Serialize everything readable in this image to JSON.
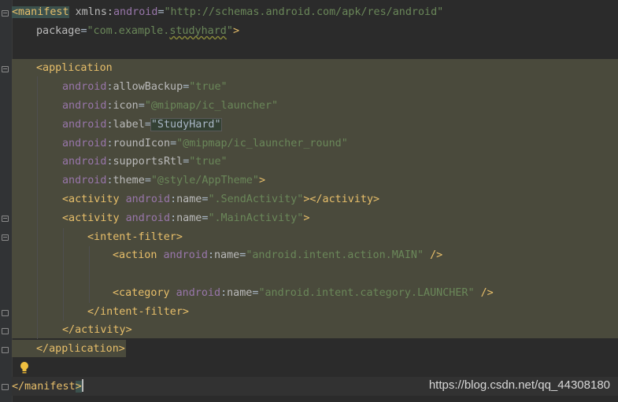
{
  "editor": {
    "lines": [
      {
        "id": "manifest-open",
        "tokens": [
          {
            "t": "tag",
            "v": "<manifest",
            "cls": "tag hl-manifest"
          },
          {
            "t": "plain",
            "v": " "
          },
          {
            "t": "attr",
            "v": "xmlns:"
          },
          {
            "t": "ns",
            "v": "android"
          },
          {
            "t": "plain",
            "v": "="
          },
          {
            "t": "val",
            "v": "\"http://schemas.android.com/apk/res/android\""
          }
        ]
      },
      {
        "id": "package",
        "tokens": [
          {
            "t": "attr",
            "v": "package"
          },
          {
            "t": "plain",
            "v": "="
          },
          {
            "t": "val",
            "v": "\"com.example."
          },
          {
            "t": "val",
            "v": "studyhard",
            "cls": "val squiggle"
          },
          {
            "t": "val",
            "v": "\""
          },
          {
            "t": "tag",
            "v": ">"
          }
        ]
      },
      {
        "id": "blank-1",
        "tokens": []
      },
      {
        "id": "application-open",
        "tokens": [
          {
            "t": "tag",
            "v": "<application"
          }
        ]
      },
      {
        "id": "allowBackup",
        "tokens": [
          {
            "t": "ns",
            "v": "android"
          },
          {
            "t": "plain",
            "v": ":"
          },
          {
            "t": "attr",
            "v": "allowBackup"
          },
          {
            "t": "plain",
            "v": "="
          },
          {
            "t": "val",
            "v": "\"true\""
          }
        ]
      },
      {
        "id": "icon",
        "tokens": [
          {
            "t": "ns",
            "v": "android"
          },
          {
            "t": "plain",
            "v": ":"
          },
          {
            "t": "attr",
            "v": "icon"
          },
          {
            "t": "plain",
            "v": "="
          },
          {
            "t": "val",
            "v": "\"@mipmap/ic_launcher\""
          }
        ]
      },
      {
        "id": "label",
        "tokens": [
          {
            "t": "ns",
            "v": "android"
          },
          {
            "t": "plain",
            "v": ":"
          },
          {
            "t": "attr",
            "v": "label"
          },
          {
            "t": "plain",
            "v": "="
          },
          {
            "t": "plain",
            "v": "\"StudyHard\"",
            "cls": "plain hl-label"
          }
        ]
      },
      {
        "id": "roundIcon",
        "tokens": [
          {
            "t": "ns",
            "v": "android"
          },
          {
            "t": "plain",
            "v": ":"
          },
          {
            "t": "attr",
            "v": "roundIcon"
          },
          {
            "t": "plain",
            "v": "="
          },
          {
            "t": "val",
            "v": "\"@mipmap/ic_launcher_round\""
          }
        ]
      },
      {
        "id": "supportsRtl",
        "tokens": [
          {
            "t": "ns",
            "v": "android"
          },
          {
            "t": "plain",
            "v": ":"
          },
          {
            "t": "attr",
            "v": "supportsRtl"
          },
          {
            "t": "plain",
            "v": "="
          },
          {
            "t": "val",
            "v": "\"true\""
          }
        ]
      },
      {
        "id": "theme",
        "tokens": [
          {
            "t": "ns",
            "v": "android"
          },
          {
            "t": "plain",
            "v": ":"
          },
          {
            "t": "attr",
            "v": "theme"
          },
          {
            "t": "plain",
            "v": "="
          },
          {
            "t": "val",
            "v": "\"@style/AppTheme\""
          },
          {
            "t": "tag",
            "v": ">"
          }
        ]
      },
      {
        "id": "activity-send",
        "tokens": [
          {
            "t": "tag",
            "v": "<activity "
          },
          {
            "t": "ns",
            "v": "android"
          },
          {
            "t": "plain",
            "v": ":"
          },
          {
            "t": "attr",
            "v": "name"
          },
          {
            "t": "plain",
            "v": "="
          },
          {
            "t": "val",
            "v": "\".SendActivity\""
          },
          {
            "t": "tag",
            "v": "></activity>"
          }
        ]
      },
      {
        "id": "activity-main",
        "tokens": [
          {
            "t": "tag",
            "v": "<activity "
          },
          {
            "t": "ns",
            "v": "android"
          },
          {
            "t": "plain",
            "v": ":"
          },
          {
            "t": "attr",
            "v": "name"
          },
          {
            "t": "plain",
            "v": "="
          },
          {
            "t": "val",
            "v": "\".MainActivity\""
          },
          {
            "t": "tag",
            "v": ">"
          }
        ]
      },
      {
        "id": "intent-filter-open",
        "tokens": [
          {
            "t": "tag",
            "v": "<intent-filter>"
          }
        ]
      },
      {
        "id": "action",
        "tokens": [
          {
            "t": "tag",
            "v": "<action "
          },
          {
            "t": "ns",
            "v": "android"
          },
          {
            "t": "plain",
            "v": ":"
          },
          {
            "t": "attr",
            "v": "name"
          },
          {
            "t": "plain",
            "v": "="
          },
          {
            "t": "val",
            "v": "\"android.intent.action.MAIN\""
          },
          {
            "t": "tag",
            "v": " />"
          }
        ]
      },
      {
        "id": "blank-2",
        "tokens": []
      },
      {
        "id": "category",
        "tokens": [
          {
            "t": "tag",
            "v": "<category "
          },
          {
            "t": "ns",
            "v": "android"
          },
          {
            "t": "plain",
            "v": ":"
          },
          {
            "t": "attr",
            "v": "name"
          },
          {
            "t": "plain",
            "v": "="
          },
          {
            "t": "val",
            "v": "\"android.intent.category.LAUNCHER\""
          },
          {
            "t": "tag",
            "v": " />"
          }
        ]
      },
      {
        "id": "intent-filter-close",
        "tokens": [
          {
            "t": "tag",
            "v": "</intent-filter>"
          }
        ]
      },
      {
        "id": "activity-close",
        "tokens": [
          {
            "t": "tag",
            "v": "</activity>"
          }
        ]
      },
      {
        "id": "application-close",
        "tokens": [
          {
            "t": "tag",
            "v": "</application>"
          }
        ]
      },
      {
        "id": "blank-3",
        "tokens": []
      },
      {
        "id": "manifest-close",
        "tokens": [
          {
            "t": "tag",
            "v": "</manifest"
          },
          {
            "t": "tag",
            "v": ">",
            "cls": "tag hl-manifest"
          }
        ]
      }
    ]
  },
  "watermark": "https://blog.csdn.net/qq_44308180",
  "colors": {
    "background": "#2b2b2b",
    "tag": "#e8bf6a",
    "namespace": "#9876aa",
    "string": "#6a8759",
    "selection": "#4a4a3c"
  }
}
